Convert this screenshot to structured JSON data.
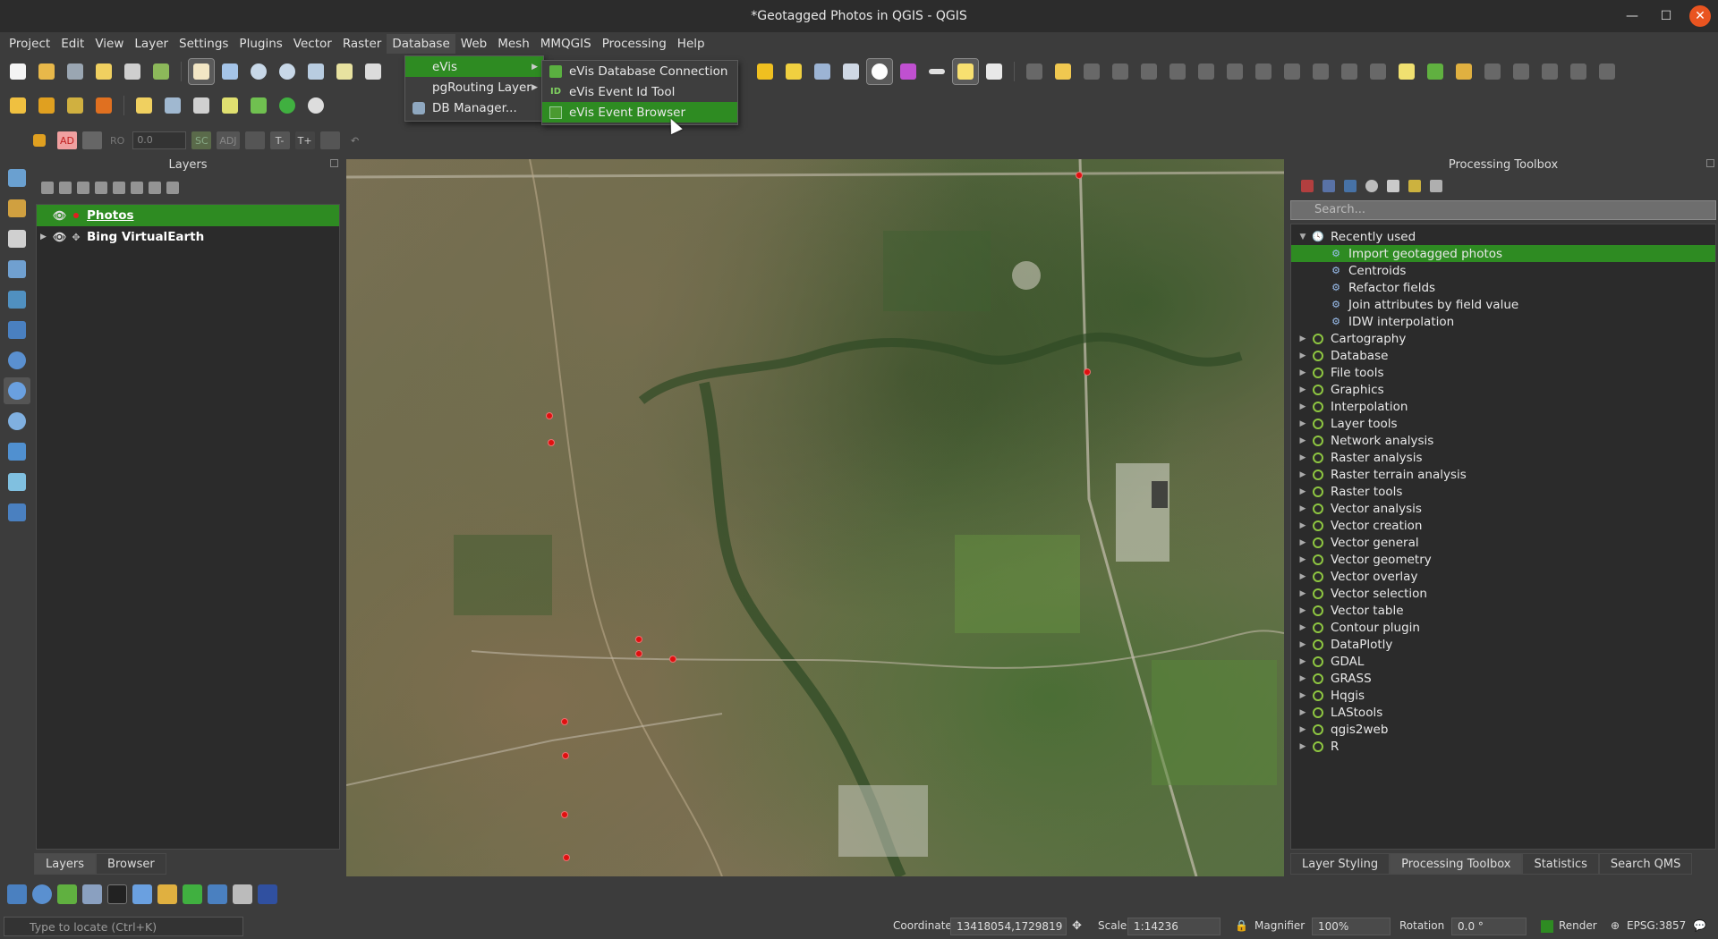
{
  "window": {
    "title": "*Geotagged Photos in QGIS - QGIS"
  },
  "menubar": [
    "Project",
    "Edit",
    "View",
    "Layer",
    "Settings",
    "Plugins",
    "Vector",
    "Raster",
    "Database",
    "Web",
    "Mesh",
    "MMQGIS",
    "Processing",
    "Help"
  ],
  "database_menu": {
    "items": [
      {
        "label": "eVis",
        "icon": "evis-icon",
        "has_submenu": true,
        "active": true
      },
      {
        "label": "pgRouting Layer",
        "icon": "",
        "has_submenu": true
      },
      {
        "label": "DB Manager...",
        "icon": "database-icon",
        "has_submenu": false
      }
    ]
  },
  "evis_submenu": {
    "items": [
      {
        "label": "eVis Database Connection",
        "icon": "evis-connect-icon"
      },
      {
        "label": "eVis Event Id Tool",
        "icon": "id-icon"
      },
      {
        "label": "eVis Event Browser",
        "icon": "evis-browser-icon",
        "highlighted": true
      }
    ]
  },
  "digitizing": {
    "ad": "AD",
    "ro": "RO",
    "value": "0.0",
    "sc": "SC",
    "adj": "ADJ",
    "tminus": "T-",
    "tplus": "T+"
  },
  "layers_panel": {
    "title": "Layers",
    "layers": [
      {
        "name": "Photos",
        "visible": true,
        "selected": true,
        "symbol": "point"
      },
      {
        "name": "Bing VirtualEarth",
        "visible": true,
        "selected": false,
        "symbol": "raster",
        "expandable": true
      }
    ],
    "tabs": [
      "Layers",
      "Browser"
    ]
  },
  "processing_toolbox": {
    "title": "Processing Toolbox",
    "search_placeholder": "Search...",
    "recently_used_label": "Recently used",
    "recent": [
      "Import geotagged photos",
      "Centroids",
      "Refactor fields",
      "Join attributes by field value",
      "IDW interpolation"
    ],
    "groups": [
      "Cartography",
      "Database",
      "File tools",
      "Graphics",
      "Interpolation",
      "Layer tools",
      "Network analysis",
      "Raster analysis",
      "Raster terrain analysis",
      "Raster tools",
      "Vector analysis",
      "Vector creation",
      "Vector general",
      "Vector geometry",
      "Vector overlay",
      "Vector selection",
      "Vector table",
      "Contour plugin",
      "DataPlotly",
      "GDAL",
      "GRASS",
      "Hqgis",
      "LAStools",
      "qgis2web",
      "R"
    ],
    "tabs": [
      "Layer Styling",
      "Processing Toolbox",
      "Statistics",
      "Search QMS"
    ]
  },
  "statusbar": {
    "locate_placeholder": "Type to locate (Ctrl+K)",
    "coordinate_label": "Coordinate",
    "coordinate_value": "13418054,1729819",
    "scale_label": "Scale",
    "scale_value": "1:14236",
    "magnifier_label": "Magnifier",
    "magnifier_value": "100%",
    "rotation_label": "Rotation",
    "rotation_value": "0.0 °",
    "render_label": "Render",
    "crs": "EPSG:3857"
  },
  "colors": {
    "selection": "#2e8b22",
    "photo_point": "#e01010",
    "close_button": "#e95420"
  }
}
